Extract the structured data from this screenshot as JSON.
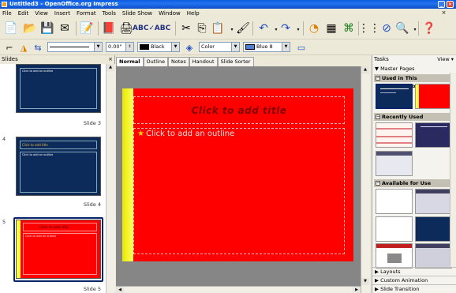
{
  "window": {
    "title": "Untitled3 - OpenOffice.org Impress"
  },
  "menu": [
    "File",
    "Edit",
    "View",
    "Insert",
    "Format",
    "Tools",
    "Slide Show",
    "Window",
    "Help"
  ],
  "toolbar2": {
    "line_width": "0.00\"",
    "line_color": "Black",
    "area_style": "Color",
    "area_color": "Blue 8"
  },
  "slides_panel": {
    "title": "Slides",
    "close": "×",
    "slides": [
      {
        "label": "Slide 3",
        "number": "",
        "title": "",
        "outline": "Click to add an outline"
      },
      {
        "label": "Slide 4",
        "number": "4",
        "title": "Click to add title",
        "outline": "Click to add an outline"
      },
      {
        "label": "Slide 5",
        "number": "5",
        "title": "Click to add title",
        "outline": "Click to add an outline"
      }
    ]
  },
  "tabs": [
    "Normal",
    "Outline",
    "Notes",
    "Handout",
    "Slide Sorter"
  ],
  "slide": {
    "title_placeholder": "Click to add title",
    "outline_placeholder": "Click to add an outline"
  },
  "tasks_panel": {
    "title": "Tasks",
    "view": "View ▾",
    "master_pages": "Master Pages",
    "used": "Used in This Presentation",
    "recent": "Recently Used",
    "available": "Available for Use",
    "bottom": [
      "Layouts",
      "Custom Animation",
      "Slide Transition"
    ]
  },
  "colors": {
    "slide_bg": "#ff0000",
    "slide_title": "#800000",
    "accent_yellow": "#ffff00",
    "thumb_blue": "#0d2b5a"
  }
}
